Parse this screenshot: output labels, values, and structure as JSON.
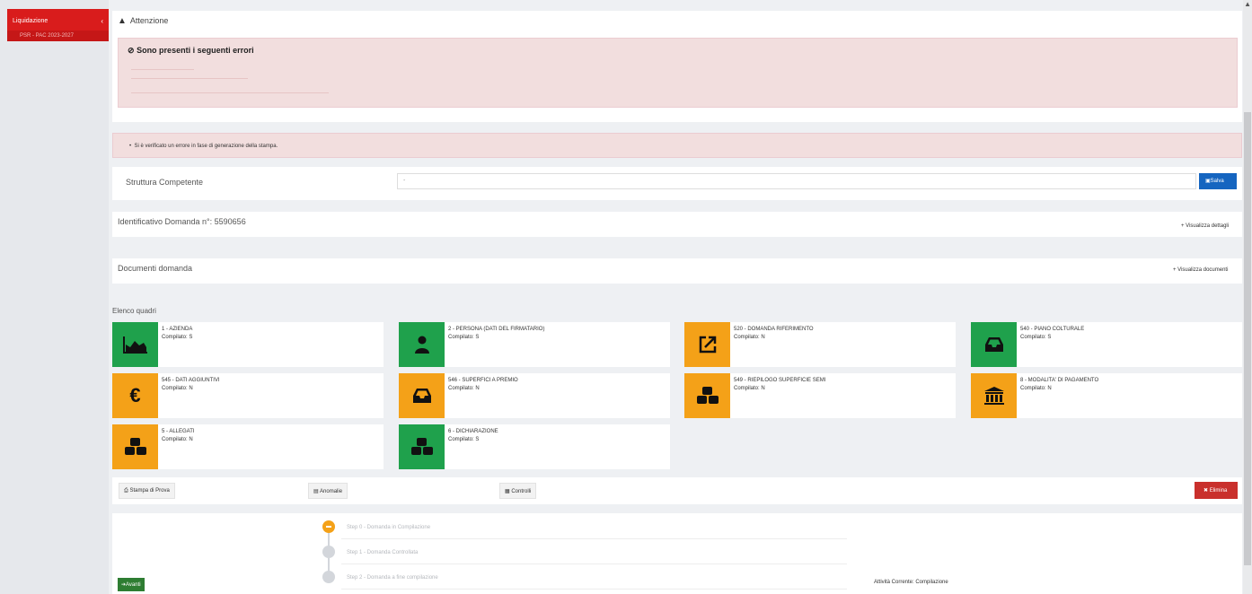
{
  "sidebar": {
    "top_item": "Liquidazione",
    "sub_item": "PSR - PAC 2023-2027"
  },
  "alert": {
    "title": "Attenzione",
    "error_heading": "Sono presenti i seguenti errori"
  },
  "message": "Si è verificato un errore in fase di generazione della stampa.",
  "struttura": {
    "label": "Struttura Competente",
    "select_value": "-",
    "save_button": "Salva"
  },
  "identificativo": {
    "label": "Identificativo Domanda n°: 5590656",
    "link": "Visualizza dettagli"
  },
  "documenti": {
    "label": "Documenti domanda",
    "link": "Visualizza documenti"
  },
  "quadri": {
    "heading": "Elenco quadri",
    "items": [
      {
        "title": "1 - AZIENDA",
        "status": "Compilato: S",
        "color": "green",
        "icon": "area-chart-icon"
      },
      {
        "title": "2 - PERSONA (DATI DEL FIRMATARIO)",
        "status": "Compilato: S",
        "color": "green",
        "icon": "user-icon"
      },
      {
        "title": "520 - DOMANDA RIFERIMENTO",
        "status": "Compilato: N",
        "color": "orange",
        "icon": "external-link-icon"
      },
      {
        "title": "540 - PIANO COLTURALE",
        "status": "Compilato: S",
        "color": "green",
        "icon": "inbox-icon"
      },
      {
        "title": "545 - DATI AGGIUNTIVI",
        "status": "Compilato: N",
        "color": "orange",
        "icon": "euro-icon"
      },
      {
        "title": "546 - SUPERFICI A PREMIO",
        "status": "Compilato: N",
        "color": "orange",
        "icon": "inbox-icon"
      },
      {
        "title": "549 - RIEPILOGO SUPERFICIE SEMI",
        "status": "Compilato: N",
        "color": "orange",
        "icon": "cubes-icon"
      },
      {
        "title": "8 - MODALITA' DI PAGAMENTO",
        "status": "Compilato: N",
        "color": "orange",
        "icon": "bank-icon"
      },
      {
        "title": "5 - ALLEGATI",
        "status": "Compilato: N",
        "color": "orange",
        "icon": "cubes-icon"
      },
      {
        "title": "6 - DICHIARAZIONE",
        "status": "Compilato: S",
        "color": "green",
        "icon": "cubes-icon"
      }
    ]
  },
  "actions": {
    "stampa": "Stampa di Prova",
    "anomalie": "Anomalie",
    "controlli": "Controlli",
    "elimina": "Elimina"
  },
  "steps": [
    {
      "label": "Step 0 - Domanda in Compilazione",
      "state": "active"
    },
    {
      "label": "Step 1 - Domanda Controllata",
      "state": "todo"
    },
    {
      "label": "Step 2 - Domanda a fine compilazione",
      "state": "todo"
    }
  ],
  "footer": {
    "avanti": "Avanti",
    "attivita": "Attività Corrente: Compilazione"
  },
  "colors": {
    "green": "#1fa14c",
    "orange": "#f4a118",
    "red": "#c9302c",
    "blue": "#1565c0",
    "sidebar_red": "#d91c1c"
  }
}
